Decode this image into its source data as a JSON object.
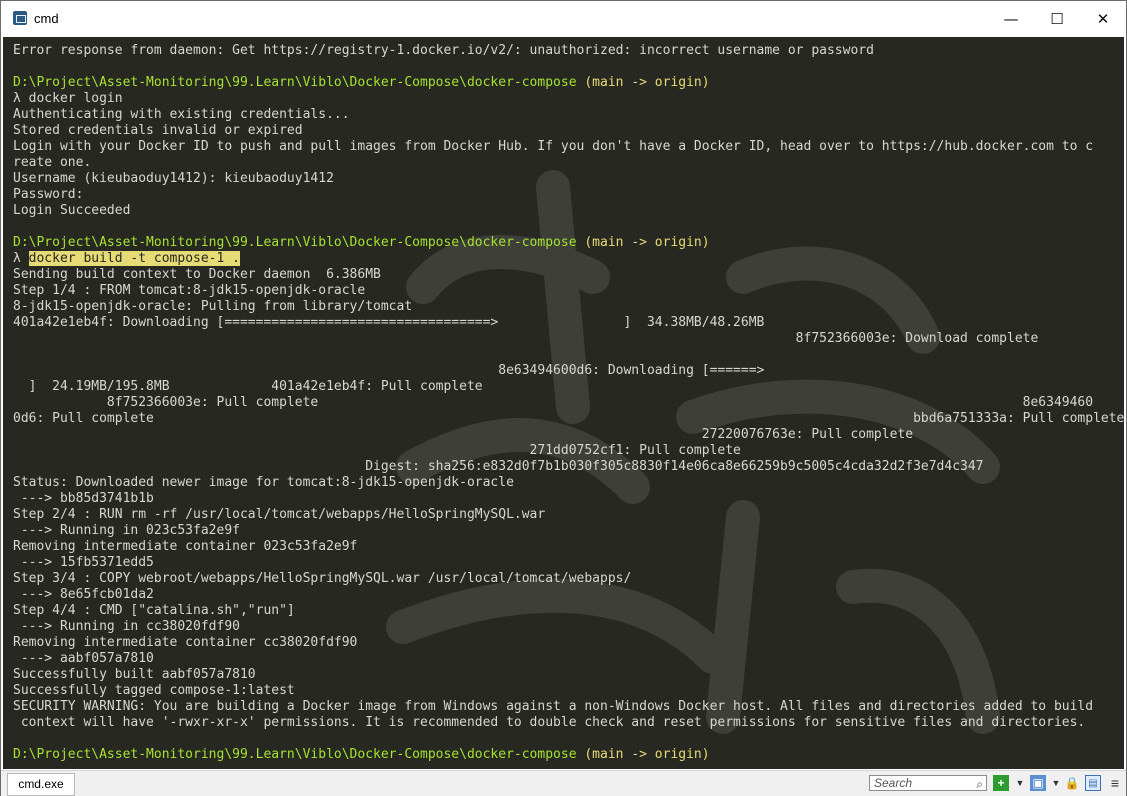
{
  "window": {
    "title": "cmd",
    "min": "—",
    "max": "☐",
    "close": "✕"
  },
  "terminal": {
    "lines": [
      {
        "text": "Error response from daemon: Get https://registry-1.docker.io/v2/: unauthorized: incorrect username or password",
        "type": "plain"
      },
      {
        "text": "",
        "type": "plain"
      },
      {
        "text": "D:\\Project\\Asset-Monitoring\\99.Learn\\Viblo\\Docker-Compose\\docker-compose (main -> origin)",
        "type": "prompt"
      },
      {
        "text": "λ docker login",
        "type": "plain"
      },
      {
        "text": "Authenticating with existing credentials...",
        "type": "plain"
      },
      {
        "text": "Stored credentials invalid or expired",
        "type": "plain"
      },
      {
        "text": "Login with your Docker ID to push and pull images from Docker Hub. If you don't have a Docker ID, head over to https://hub.docker.com to c",
        "type": "plain"
      },
      {
        "text": "reate one.",
        "type": "plain"
      },
      {
        "text": "Username (kieubaoduy1412): kieubaoduy1412",
        "type": "plain"
      },
      {
        "text": "Password:",
        "type": "plain"
      },
      {
        "text": "Login Succeeded",
        "type": "plain"
      },
      {
        "text": "",
        "type": "plain"
      },
      {
        "text": "D:\\Project\\Asset-Monitoring\\99.Learn\\Viblo\\Docker-Compose\\docker-compose (main -> origin)",
        "type": "prompt"
      },
      {
        "text": "λ docker build -t compose-1 .",
        "type": "highlight"
      },
      {
        "text": "Sending build context to Docker daemon  6.386MB",
        "type": "plain"
      },
      {
        "text": "Step 1/4 : FROM tomcat:8-jdk15-openjdk-oracle",
        "type": "plain"
      },
      {
        "text": "8-jdk15-openjdk-oracle: Pulling from library/tomcat",
        "type": "plain"
      },
      {
        "text": "401a42e1eb4f: Downloading [==================================>                ]  34.38MB/48.26MB",
        "type": "plain"
      },
      {
        "text": "                                                                                                    8f752366003e: Download complete",
        "type": "plain"
      },
      {
        "text": "",
        "type": "plain"
      },
      {
        "text": "                                                              8e63494600d6: Downloading [======>",
        "type": "plain"
      },
      {
        "text": "  ]  24.19MB/195.8MB             401a42e1eb4f: Pull complete",
        "type": "plain"
      },
      {
        "text": "            8f752366003e: Pull complete                                                                                          8e6349460",
        "type": "plain"
      },
      {
        "text": "0d6: Pull complete                                                                                                 bbd6a751333a: Pull complete",
        "type": "plain"
      },
      {
        "text": "                                                                                        27220076763e: Pull complete",
        "type": "plain"
      },
      {
        "text": "                                                                  271dd0752cf1: Pull complete",
        "type": "plain"
      },
      {
        "text": "                                             Digest: sha256:e832d0f7b1b030f305c8830f14e06ca8e66259b9c5005c4cda32d2f3e7d4c347",
        "type": "plain"
      },
      {
        "text": "Status: Downloaded newer image for tomcat:8-jdk15-openjdk-oracle",
        "type": "plain"
      },
      {
        "text": " ---> bb85d3741b1b",
        "type": "plain"
      },
      {
        "text": "Step 2/4 : RUN rm -rf /usr/local/tomcat/webapps/HelloSpringMySQL.war",
        "type": "plain"
      },
      {
        "text": " ---> Running in 023c53fa2e9f",
        "type": "plain"
      },
      {
        "text": "Removing intermediate container 023c53fa2e9f",
        "type": "plain"
      },
      {
        "text": " ---> 15fb5371edd5",
        "type": "plain"
      },
      {
        "text": "Step 3/4 : COPY webroot/webapps/HelloSpringMySQL.war /usr/local/tomcat/webapps/",
        "type": "plain"
      },
      {
        "text": " ---> 8e65fcb01da2",
        "type": "plain"
      },
      {
        "text": "Step 4/4 : CMD [\"catalina.sh\",\"run\"]",
        "type": "plain"
      },
      {
        "text": " ---> Running in cc38020fdf90",
        "type": "plain"
      },
      {
        "text": "Removing intermediate container cc38020fdf90",
        "type": "plain"
      },
      {
        "text": " ---> aabf057a7810",
        "type": "plain"
      },
      {
        "text": "Successfully built aabf057a7810",
        "type": "plain"
      },
      {
        "text": "Successfully tagged compose-1:latest",
        "type": "plain"
      },
      {
        "text": "SECURITY WARNING: You are building a Docker image from Windows against a non-Windows Docker host. All files and directories added to build",
        "type": "plain"
      },
      {
        "text": " context will have '-rwxr-xr-x' permissions. It is recommended to double check and reset permissions for sensitive files and directories.",
        "type": "plain"
      },
      {
        "text": "",
        "type": "plain"
      },
      {
        "text": "D:\\Project\\Asset-Monitoring\\99.Learn\\Viblo\\Docker-Compose\\docker-compose (main -> origin)",
        "type": "prompt"
      }
    ]
  },
  "taskbar": {
    "tab_label": "cmd.exe",
    "search_placeholder": "Search",
    "icons": {
      "search": "search-icon",
      "add": "add-icon",
      "view": "view-icon",
      "lock": "lock-icon",
      "menu": "menu-icon"
    }
  },
  "colors": {
    "background": "#272822",
    "prompt": "#a6e22e",
    "branch": "#e6db74",
    "text": "#d7d7d2"
  }
}
